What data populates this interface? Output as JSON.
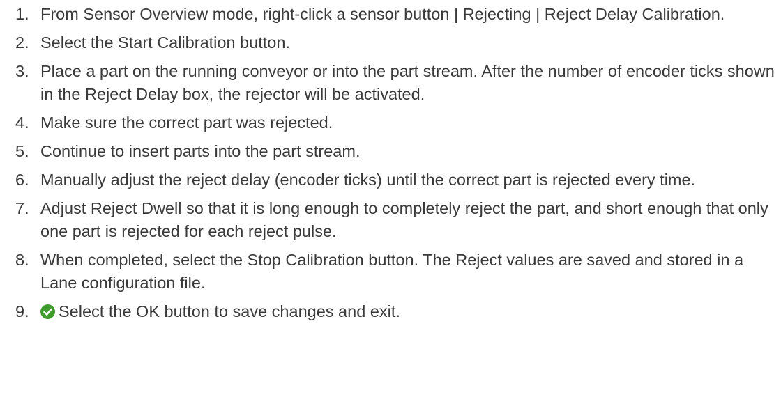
{
  "steps": [
    {
      "num": "1.",
      "text": "From Sensor Overview mode, right-click a sensor button | Rejecting | Reject Delay Calibration."
    },
    {
      "num": "2.",
      "text": "Select the Start Calibration button."
    },
    {
      "num": "3.",
      "text": "Place a part on the running conveyor or into the part stream. After the number of encoder ticks shown in the Reject Delay box, the rejector will be activated."
    },
    {
      "num": "4.",
      "text": "Make sure the correct part was rejected."
    },
    {
      "num": "5.",
      "text": "Continue to insert parts into the part stream."
    },
    {
      "num": "6.",
      "text": "Manually adjust the reject delay (encoder ticks) until the correct part is rejected every time."
    },
    {
      "num": "7.",
      "text": "Adjust Reject Dwell so that it is long enough to completely reject the part, and short enough that only one part is rejected for each reject pulse."
    },
    {
      "num": "8.",
      "text": "When completed, select the Stop Calibration button. The Reject values are saved and stored in a Lane configuration file."
    },
    {
      "num": "9.",
      "text": "Select the OK button to save changes and exit.",
      "icon": "check-circle-icon",
      "icon_color": "#3f9b2c"
    }
  ]
}
